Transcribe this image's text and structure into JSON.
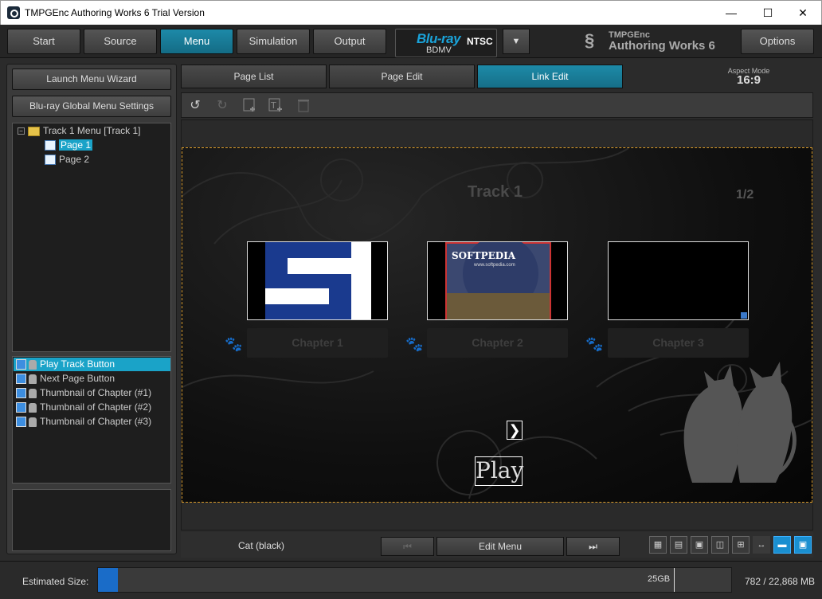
{
  "window": {
    "title": "TMPGEnc Authoring Works 6 Trial Version",
    "minimize": "—",
    "maximize": "☐",
    "close": "✕"
  },
  "topbar": {
    "buttons": [
      "Start",
      "Source",
      "Menu",
      "Simulation",
      "Output"
    ],
    "active": "Menu",
    "format_brand": "Blu-ray",
    "format_sub": "BDMV",
    "format_standard": "NTSC",
    "dropdown": "▼",
    "brand_line1": "TMPGEnc",
    "brand_line2": "Authoring Works 6",
    "options_label": "Options"
  },
  "left": {
    "wizard_label": "Launch Menu Wizard",
    "global_settings_label": "Blu-ray Global Menu Settings",
    "tree": {
      "root": "Track 1 Menu [Track 1]",
      "pages": [
        "Page 1",
        "Page 2"
      ],
      "selected": "Page 1"
    },
    "objects": [
      "Play Track Button",
      "Next Page Button",
      "Thumbnail of Chapter (#1)",
      "Thumbnail of Chapter (#2)",
      "Thumbnail of Chapter (#3)"
    ],
    "selected_object": "Play Track Button"
  },
  "tabs": {
    "items": [
      "Page List",
      "Page Edit",
      "Link Edit"
    ],
    "active": "Link Edit"
  },
  "aspect": {
    "label": "Aspect Mode",
    "value": "16:9"
  },
  "canvas": {
    "track_title": "Track 1",
    "page_number": "1/2",
    "chapters": [
      "Chapter 1",
      "Chapter 2",
      "Chapter 3"
    ],
    "thumb2_text": "SOFTPEDIA",
    "thumb2_sub": "www.softpedia.com",
    "play_label": "Play",
    "next_arrow": "❯"
  },
  "editor_bottom": {
    "theme_name": "Cat (black)",
    "prev_label": "⏮",
    "edit_menu_label": "Edit Menu",
    "next_label": "⏭"
  },
  "status": {
    "label": "Estimated Size:",
    "fill_fraction": 0.032,
    "capacity": "25GB",
    "usage": "782 / 22,868 MB"
  },
  "colors": {
    "accent": "#1d8aa8",
    "selection": "#1aa3c8",
    "progress": "#1a6cc8",
    "canvas_border": "#d89a2a"
  }
}
